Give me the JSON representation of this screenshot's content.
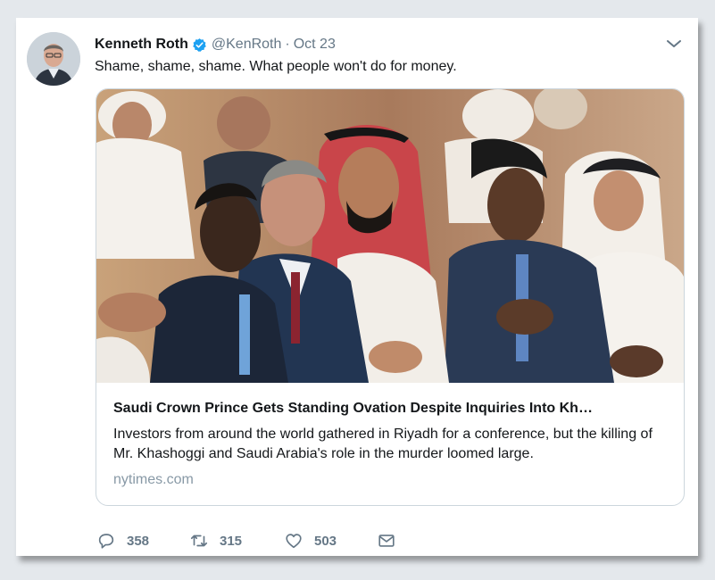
{
  "tweet": {
    "author_name": "Kenneth Roth",
    "handle": "@KenRoth",
    "separator": "·",
    "date": "Oct 23",
    "text": "Shame, shame, shame. What people won't do for money."
  },
  "link_card": {
    "title": "Saudi Crown Prince Gets Standing Ovation Despite Inquiries Into Kh…",
    "description": "Investors from around the world gathered in Riyadh for a conference, but the killing of Mr. Khashoggi and Saudi Arabia's role in the murder loomed large.",
    "domain": "nytimes.com"
  },
  "actions": {
    "reply_count": "358",
    "retweet_count": "315",
    "like_count": "503"
  },
  "icons": {
    "verified": "verified-badge-icon",
    "caret": "chevron-down-icon",
    "reply": "reply-icon",
    "retweet": "retweet-icon",
    "like": "heart-icon",
    "dm": "envelope-icon"
  },
  "colors": {
    "verified_blue": "#1da1f2",
    "secondary_text": "#657786",
    "domain_text": "#8899a6",
    "card_border": "#ccd6dd"
  }
}
